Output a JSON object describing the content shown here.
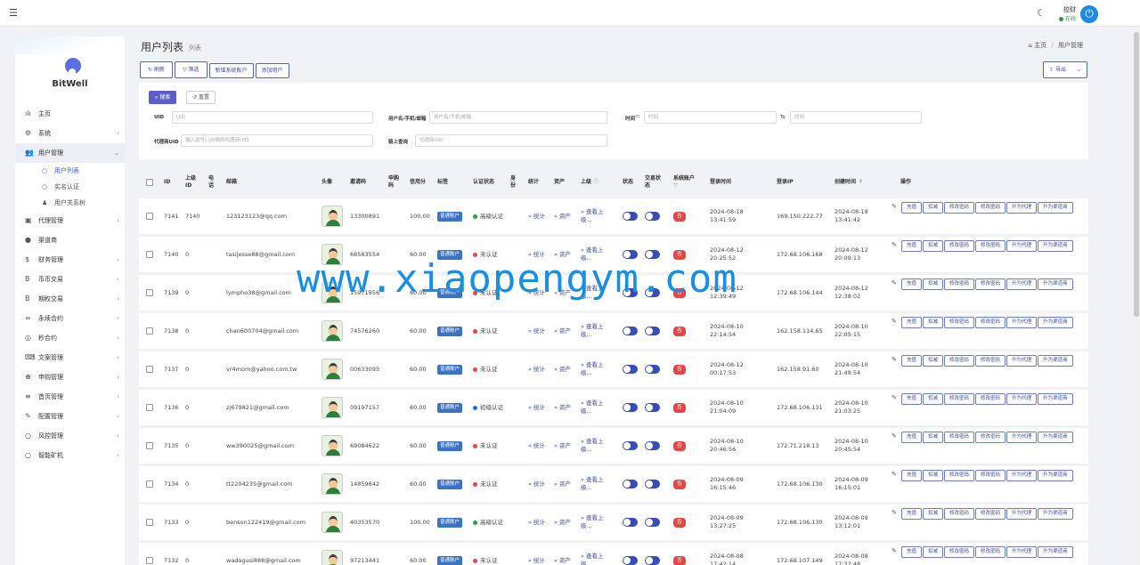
{
  "topbar": {
    "menu_icon": "menu-icon",
    "theme_icon": "moon-icon",
    "user": "狡财",
    "status": "在线",
    "power_icon": "power-icon"
  },
  "brand": "BitWell",
  "menu": [
    {
      "label": "主页",
      "icon": "chart-icon",
      "chev": ""
    },
    {
      "label": "系统",
      "icon": "gear-icon",
      "chev": "‹"
    },
    {
      "label": "用户管理",
      "icon": "users-icon",
      "chev": "⌄",
      "active": true
    },
    {
      "label": "用户列表",
      "sub": true,
      "active": true
    },
    {
      "label": "实名认证",
      "sub": true
    },
    {
      "label": "用户关系树",
      "sub": true
    },
    {
      "label": "代理管理",
      "icon": "card-icon",
      "chev": "‹"
    },
    {
      "label": "渠道商",
      "icon": "person-icon",
      "chev": ""
    },
    {
      "label": "财务管理",
      "icon": "dollar-icon",
      "chev": "‹"
    },
    {
      "label": "币币交易",
      "icon": "bitcoin-icon",
      "chev": "‹"
    },
    {
      "label": "期权交易",
      "icon": "bitcoin-icon",
      "chev": "‹"
    },
    {
      "label": "永续合约",
      "icon": "link-icon",
      "chev": "‹"
    },
    {
      "label": "秒合约",
      "icon": "target-icon",
      "chev": "‹"
    },
    {
      "label": "文案管理",
      "icon": "keyboard-icon",
      "chev": "‹"
    },
    {
      "label": "申购管理",
      "icon": "globe-icon",
      "chev": "‹"
    },
    {
      "label": "首页管理",
      "icon": "list-icon",
      "chev": "‹"
    },
    {
      "label": "配置管理",
      "icon": "wrench-icon",
      "chev": "‹"
    },
    {
      "label": "风控管理",
      "icon": "circle-icon",
      "chev": "‹"
    },
    {
      "label": "智能矿机",
      "icon": "circle-icon",
      "chev": "‹"
    }
  ],
  "page": {
    "title": "用户列表",
    "subtitle": "列表",
    "crumb_home": "主页",
    "crumb_sep": "/",
    "crumb_current": "用户管理"
  },
  "toolbar": {
    "refresh": "刷新",
    "filter": "筛选",
    "new_system": "新增系统账户",
    "add_user": "添加用户",
    "export": "导出"
  },
  "filter": {
    "search": "搜索",
    "reset": "重置",
    "uid_label": "UID",
    "uid_ph": "UID",
    "user_label": "用户名/手机/邮箱",
    "user_ph": "用户名/手机/邮箱",
    "time_label": "时间",
    "time_ph": "时间",
    "to": "To",
    "time_ph2": "时间",
    "agent_label": "代理商UID",
    "agent_ph": "输入逗号(,)分隔的代理商UID",
    "parent_label": "链上查询",
    "parent_ph": "代理商UID"
  },
  "columns": {
    "id": "ID",
    "parent_id": "上级ID",
    "phone": "电话",
    "email": "邮箱",
    "avatar": "头像",
    "invite": "邀请码",
    "apply": "申购码",
    "credit": "信用分",
    "tag": "标签",
    "kyc": "认证状态",
    "identity": "身份",
    "stats": "统计",
    "assets": "资产",
    "parent": "上级",
    "status": "状态",
    "trade_status": "交易状态",
    "sys_acct": "系统账户",
    "login_time": "登录时间",
    "login_ip": "登录IP",
    "created": "创建时间",
    "ops": "操作"
  },
  "row_text": {
    "acct": "普通账户",
    "stats": "» 统计",
    "assets": "» 资产",
    "parent": "» 查看上级...",
    "no": "否"
  },
  "ops": [
    "充值",
    "扣减",
    "修改密码",
    "修改密码",
    "升为代理",
    "升为渠道商"
  ],
  "rows": [
    {
      "id": "7141",
      "pid": "7140",
      "email": "123123123@qq.com",
      "invite": "13300891",
      "credit": "100.00",
      "kyc": "高级认证",
      "kyc_color": "#2e9b45",
      "login": "2024-08-18 13:41:59",
      "ip": "169.150.222.77",
      "created": "2024-08-18 13:41:42"
    },
    {
      "id": "7140",
      "pid": "0",
      "email": "tasijesse88@gmail.com",
      "invite": "68583554",
      "credit": "60.00",
      "kyc": "未认证",
      "kyc_color": "#e04848",
      "login": "2024-08-12 20:25:52",
      "ip": "172.68.106.168",
      "created": "2024-08-12 20:09:13"
    },
    {
      "id": "7139",
      "pid": "0",
      "email": "lympho38@gmail.com",
      "invite": "15971956",
      "credit": "60.00",
      "kyc": "未认证",
      "kyc_color": "#e04848",
      "login": "2024-08-12 12:39:49",
      "ip": "172.68.106.144",
      "created": "2024-08-12 12:38:02"
    },
    {
      "id": "7138",
      "pid": "0",
      "email": "chan600704@gmail.com",
      "invite": "74576260",
      "credit": "60.00",
      "kyc": "未认证",
      "kyc_color": "#e04848",
      "login": "2024-08-10 22:14:54",
      "ip": "162.158.114.65",
      "created": "2024-08-10 22:05:15"
    },
    {
      "id": "7137",
      "pid": "0",
      "email": "vr4mom@yahoo.com.tw",
      "invite": "00633095",
      "credit": "60.00",
      "kyc": "未认证",
      "kyc_color": "#e04848",
      "login": "2024-08-12 00:17:53",
      "ip": "162.158.91.60",
      "created": "2024-08-10 21:49:54"
    },
    {
      "id": "7136",
      "pid": "0",
      "email": "zj679821@gmail.com",
      "invite": "09197157",
      "credit": "60.00",
      "kyc": "初级认证",
      "kyc_color": "#1e6fd9",
      "login": "2024-08-10 21:04:09",
      "ip": "172.68.106.131",
      "created": "2024-08-10 21:03:25"
    },
    {
      "id": "7135",
      "pid": "0",
      "email": "ww390025@gmail.com",
      "invite": "69084622",
      "credit": "60.00",
      "kyc": "未认证",
      "kyc_color": "#e04848",
      "login": "2024-08-10 20:46:56",
      "ip": "172.71.218.13",
      "created": "2024-08-10 20:45:54"
    },
    {
      "id": "7134",
      "pid": "0",
      "email": "tt2204235@gmail.com",
      "invite": "14859842",
      "credit": "60.00",
      "kyc": "未认证",
      "kyc_color": "#e04848",
      "login": "2024-08-09 16:15:46",
      "ip": "172.68.106.130",
      "created": "2024-08-09 16:15:01"
    },
    {
      "id": "7133",
      "pid": "0",
      "email": "benson122419@gmail.com",
      "invite": "40353570",
      "credit": "100.00",
      "kyc": "高级认证",
      "kyc_color": "#2e9b45",
      "login": "2024-08-09 13:27:25",
      "ip": "172.68.106.130",
      "created": "2024-08-09 13:12:01"
    },
    {
      "id": "7132",
      "pid": "0",
      "email": "wadagusi888@gmail.com",
      "invite": "97213441",
      "credit": "60.00",
      "kyc": "未认证",
      "kyc_color": "#e04848",
      "login": "2024-08-08 17:42:14",
      "ip": "172.68.107.149",
      "created": "2024-08-08 17:32:48"
    }
  ],
  "watermark": "www.xiaopengym.com"
}
